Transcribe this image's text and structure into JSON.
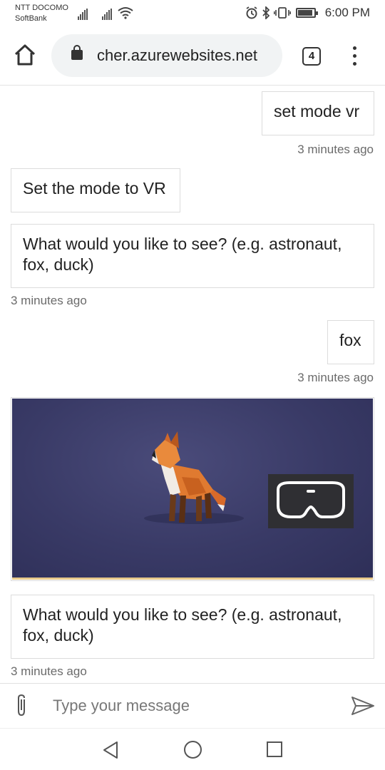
{
  "status_bar": {
    "carrier_1": "NTT DOCOMO",
    "carrier_2": "SoftBank",
    "time": "6:00 PM",
    "icons": [
      "signal-icon",
      "wifi-icon",
      "alarm-icon",
      "bluetooth-icon",
      "vibrate-icon",
      "battery-icon"
    ]
  },
  "browser": {
    "url": "cher.azurewebsites.net",
    "tab_count": "4"
  },
  "messages": [
    {
      "from": "user",
      "text": "set mode vr"
    },
    {
      "from": "user",
      "timestamp": "3 minutes ago"
    },
    {
      "from": "bot",
      "text": "Set the mode to VR"
    },
    {
      "from": "bot",
      "text": "What would you like to see? (e.g. astronaut, fox, duck)"
    },
    {
      "from": "bot",
      "timestamp": "3 minutes ago"
    },
    {
      "from": "user",
      "text": "fox"
    },
    {
      "from": "user",
      "timestamp": "3 minutes ago"
    },
    {
      "from": "bot",
      "card": "3d-scene",
      "subject": "fox"
    },
    {
      "from": "bot",
      "text": "What would you like to see? (e.g. astronaut, fox, duck)"
    },
    {
      "from": "bot",
      "timestamp": "3 minutes ago"
    }
  ],
  "composer": {
    "placeholder": "Type your message"
  },
  "colors": {
    "scene_background": "#393a66",
    "vr_button": "#2f2f33",
    "bubble_border": "#dcdcdc"
  }
}
